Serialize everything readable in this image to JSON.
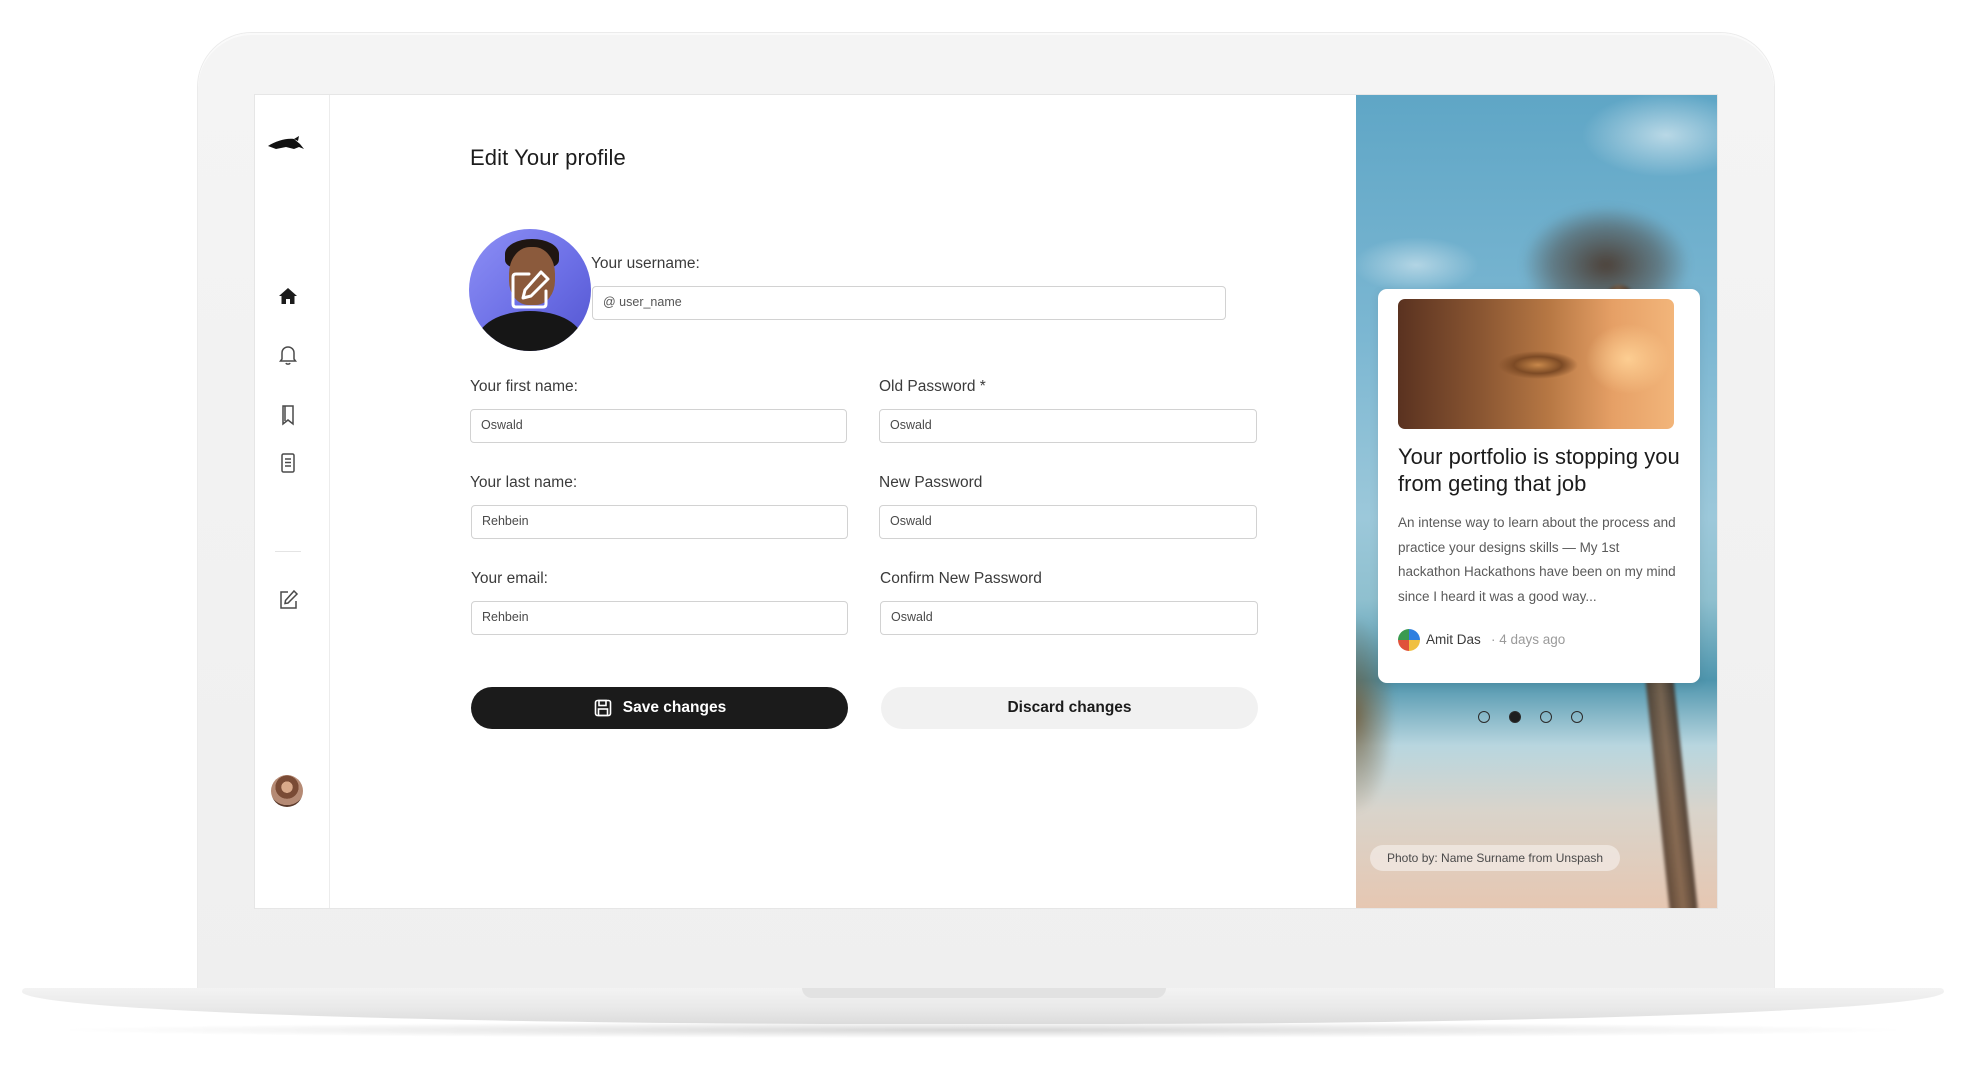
{
  "page": {
    "title": "Edit Your profile"
  },
  "sidebar": {
    "items": [
      {
        "name": "home",
        "icon": "home-icon",
        "active": true
      },
      {
        "name": "notifications",
        "icon": "bell-icon",
        "active": false
      },
      {
        "name": "bookmarks",
        "icon": "bookmark-icon",
        "active": false
      },
      {
        "name": "documents",
        "icon": "document-icon",
        "active": false
      },
      {
        "name": "edit",
        "icon": "edit-icon",
        "active": false
      }
    ]
  },
  "form": {
    "username": {
      "label": "Your username:",
      "placeholder": "@ user_name"
    },
    "first_name": {
      "label": "Your first name:",
      "value": "Oswald"
    },
    "last_name": {
      "label": "Your last name:",
      "value": "Rehbein"
    },
    "email": {
      "label": "Your email:",
      "value": "Rehbein"
    },
    "old_password": {
      "label": "Old Password *",
      "value": "Oswald"
    },
    "new_password": {
      "label": "New Password",
      "value": "Oswald"
    },
    "confirm_password": {
      "label": "Confirm New Password",
      "value": "Oswald"
    }
  },
  "actions": {
    "save_label": "Save changes",
    "discard_label": "Discard changes"
  },
  "article": {
    "title": "Your portfolio is stopping you from geting that job",
    "description": "An intense way to learn about the process and practice your designs skills — My 1st hackathon Hackathons have been on my mind since I heard it was a good way...",
    "author": "Amit Das",
    "time": "· 4 days ago"
  },
  "carousel": {
    "count": 4,
    "active_index": 1
  },
  "photo_credit": "Photo by: Name Surname from Unspash",
  "colors": {
    "accent": "#1b1b1b",
    "avatar_bg": "#7a7de9",
    "secondary_btn": "#f1f1f1"
  }
}
